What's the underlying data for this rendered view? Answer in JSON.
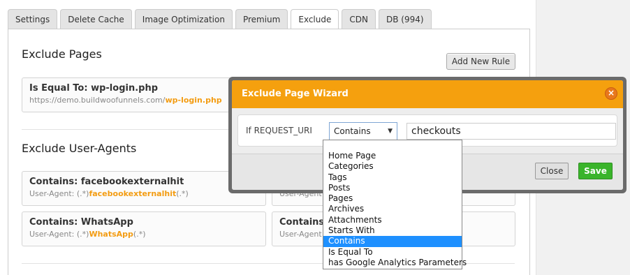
{
  "tabs": [
    {
      "label": "Settings"
    },
    {
      "label": "Delete Cache"
    },
    {
      "label": "Image Optimization"
    },
    {
      "label": "Premium"
    },
    {
      "label": "Exclude"
    },
    {
      "label": "CDN"
    },
    {
      "label": "DB (994)"
    }
  ],
  "active_tab": "Exclude",
  "exclude_pages": {
    "title": "Exclude Pages",
    "add_button": "Add New Rule",
    "rules": [
      {
        "title": "Is Equal To: wp-login.php",
        "sub_prefix": "https://demo.buildwoofunnels.com/",
        "sub_highlight": "wp-login.php",
        "sub_suffix": ""
      }
    ]
  },
  "exclude_user_agents": {
    "title": "Exclude User-Agents",
    "rules": [
      {
        "title": "Contains: facebookexternalhit",
        "sub_prefix": "User-Agent: (.*)",
        "sub_highlight": "facebookexternalhit",
        "sub_suffix": "(.*)"
      },
      {
        "title": "",
        "sub_prefix": "User-Agent",
        "sub_highlight": "",
        "sub_suffix": ""
      },
      {
        "title": "Contains: WhatsApp",
        "sub_prefix": "User-Agent: (.*)",
        "sub_highlight": "WhatsApp",
        "sub_suffix": "(.*)"
      },
      {
        "title": "Contains:",
        "sub_prefix": "User-Agent",
        "sub_highlight": "",
        "sub_suffix": ""
      }
    ]
  },
  "wizard": {
    "title": "Exclude Page Wizard",
    "close_icon": "close-icon",
    "condition_label": "If REQUEST_URI",
    "operator_selected": "Contains",
    "value": "checkouts",
    "close_button": "Close",
    "save_button": "Save",
    "dropdown_options": [
      "Home Page",
      "Categories",
      "Tags",
      "Posts",
      "Pages",
      "Archives",
      "Attachments",
      "Starts With",
      "Contains",
      "Is Equal To",
      "has Google Analytics Parameters"
    ],
    "dropdown_highlighted": "Contains"
  },
  "colors": {
    "accent_orange": "#f5a00e",
    "highlight_text": "#f39c12",
    "save_green": "#3ab42b",
    "selected_blue": "#1e90ff"
  }
}
